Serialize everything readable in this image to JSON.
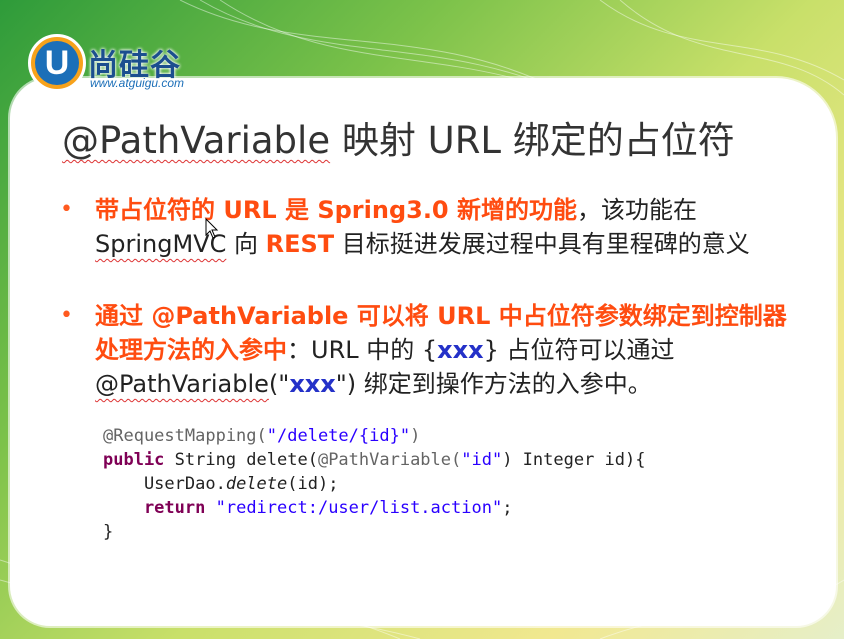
{
  "logo": {
    "letter": "U",
    "name": "尚硅谷",
    "url": "www.atguigu.com"
  },
  "title": {
    "annotation": "@PathVariable",
    "rest": " 映射 URL 绑定的占位符"
  },
  "bullet1": {
    "marker": "•",
    "hl": "带占位符的 URL 是 Spring3.0 新增的功能",
    "t1": "，该功能在",
    "t2": "SpringMVC",
    "t3": " 向 ",
    "hl2": "REST",
    "t4": " 目标挺进发展过程中具有里程碑的意义"
  },
  "bullet2": {
    "marker": "•",
    "hl": "通过 @PathVariable 可以将 URL 中占位符参数绑定到控制器处理方法的入参中",
    "t1": "：URL 中的 {",
    "b1": "xxx",
    "t2": "} 占位符可以通过 ",
    "t3": "@PathVariable",
    "t4": "(\"",
    "b2": "xxx",
    "t5": "\") 绑定到操作方法的入参中。"
  },
  "code": {
    "l1_ann": "@RequestMapping(",
    "l1_str": "\"/delete/{id}\"",
    "l1_end": ")",
    "l2_kw": "public",
    "l2_a": " String delete(",
    "l2_ann": "@PathVariable(",
    "l2_str": "\"id\"",
    "l2_b": ") Integer id){",
    "l3_a": "    UserDao.",
    "l3_it": "delete",
    "l3_b": "(id);",
    "l4_kw": "    return",
    "l4_sp": " ",
    "l4_str": "\"redirect:/user/list.action\"",
    "l4_end": ";",
    "l5": "}"
  },
  "colors": {
    "highlight": "#ff4c10",
    "blue": "#2431c8",
    "keyword": "#7f0055",
    "string": "#2a00ff"
  }
}
